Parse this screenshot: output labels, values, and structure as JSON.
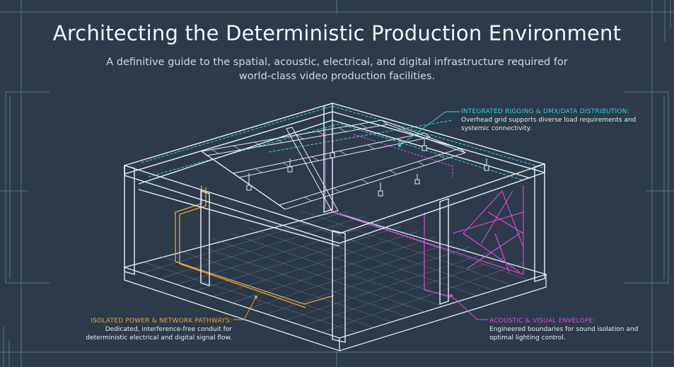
{
  "header": {
    "title": "Architecting the Deterministic Production Environment",
    "subtitle": "A definitive guide to the spatial, acoustic, electrical, and digital infrastructure required for world-class video production facilities."
  },
  "callouts": {
    "rigging": {
      "title": "INTEGRATED RIGGING & DMX/DATA DISTRIBUTION:",
      "body": "Overhead grid supports diverse load requirements and systemic connectivity."
    },
    "power": {
      "title": "ISOLATED POWER & NETWORK PATHWAYS:",
      "body": "Dedicated, interference-free conduit for deterministic electrical and digital signal flow."
    },
    "acoustic": {
      "title": "ACOUSTIC & VISUAL ENVELOPE:",
      "body": "Engineered boundaries for sound isolation and optimal lighting control."
    }
  },
  "colors": {
    "background": "#2c3a4a",
    "structure": "#e8eef4",
    "rigging_accent": "#2fd4d8",
    "power_accent": "#f0a63a",
    "acoustic_accent": "#e04bd8"
  }
}
